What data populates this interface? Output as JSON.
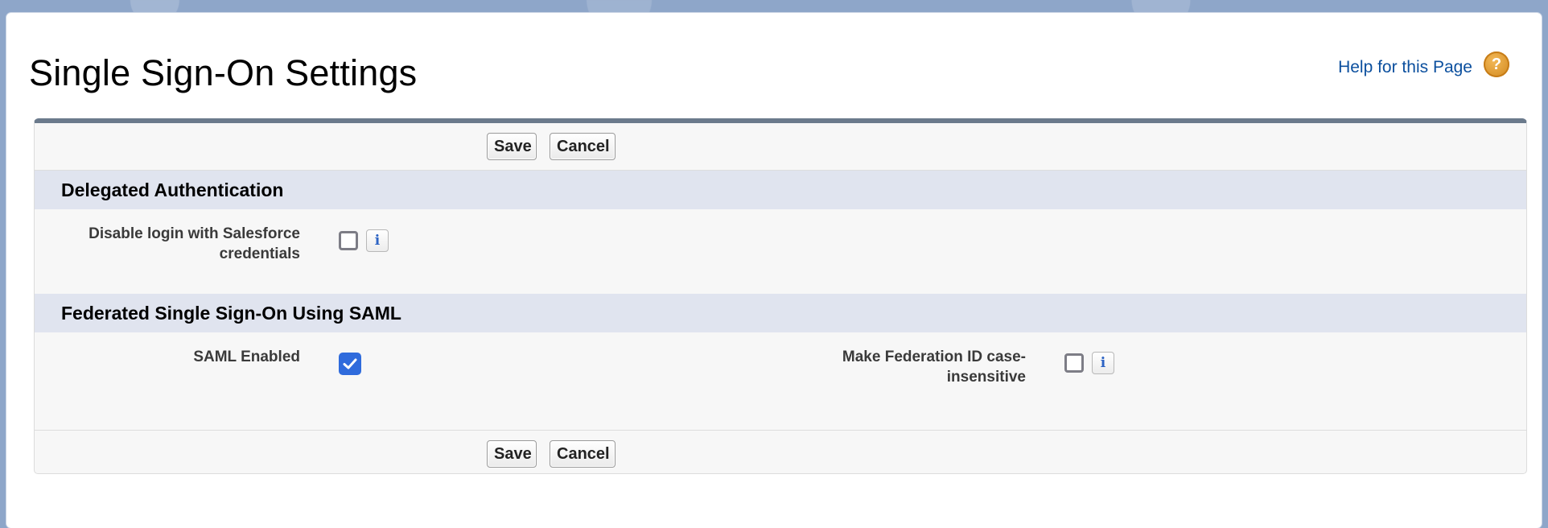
{
  "page": {
    "title": "Single Sign-On Settings",
    "help_link": "Help for this Page",
    "help_icon": "question-mark-icon"
  },
  "buttons": {
    "save": "Save",
    "cancel": "Cancel"
  },
  "sections": {
    "delegated": {
      "title": "Delegated Authentication",
      "fields": {
        "disable_login": {
          "label_line1": "Disable login with Salesforce",
          "label_line2": "credentials",
          "checked": false,
          "info_glyph": "i"
        }
      }
    },
    "saml": {
      "title": "Federated Single Sign-On Using SAML",
      "fields": {
        "saml_enabled": {
          "label": "SAML Enabled",
          "checked": true
        },
        "federation_case": {
          "label_line1": "Make Federation ID case-",
          "label_line2": "insensitive",
          "checked": false,
          "info_glyph": "i"
        }
      }
    }
  },
  "colors": {
    "accent_checkbox": "#2f6bdc",
    "link": "#0b4f9e",
    "section_header_bg": "#e0e4ef"
  }
}
